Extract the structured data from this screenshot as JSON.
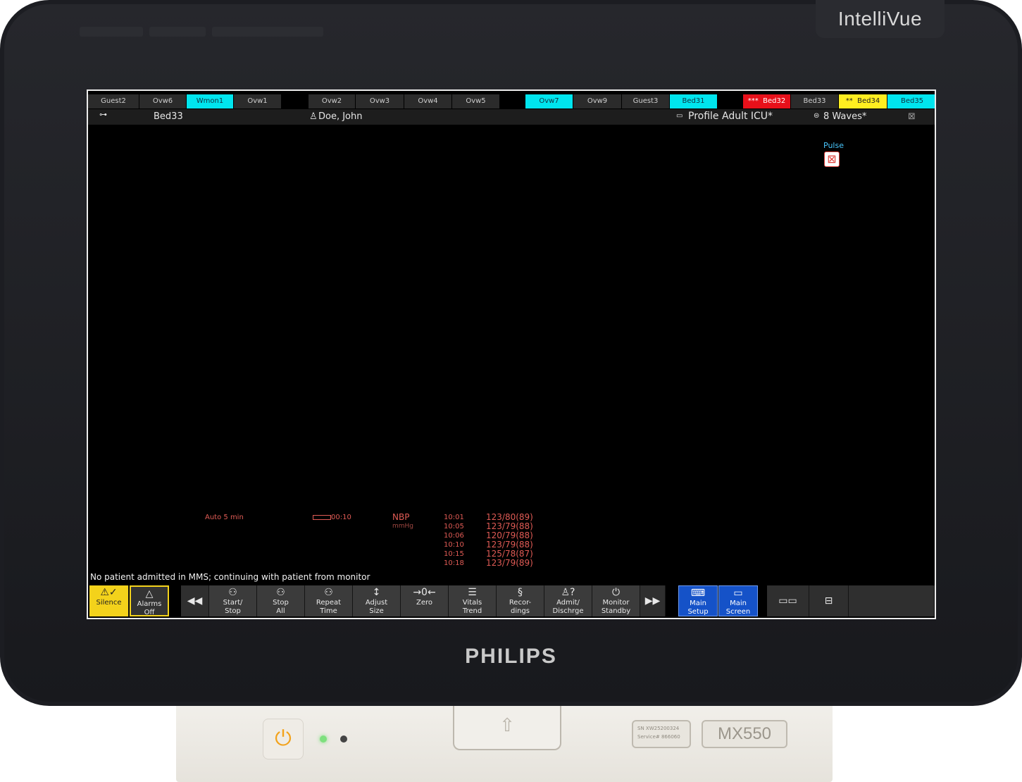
{
  "brand": {
    "product": "IntelliVue",
    "maker": "PHILIPS",
    "model": "MX550"
  },
  "serial_label": {
    "sn": "SN XW25200324",
    "service": "Service# 866060"
  },
  "tabs": [
    {
      "label": "Guest2",
      "state": "normal"
    },
    {
      "label": "Ovw6",
      "state": "normal"
    },
    {
      "label": "Wmon1",
      "state": "cyan"
    },
    {
      "label": "Ovw1",
      "state": "normal"
    },
    {
      "label": "Ovw2",
      "state": "normal"
    },
    {
      "label": "Ovw3",
      "state": "normal"
    },
    {
      "label": "Ovw4",
      "state": "normal"
    },
    {
      "label": "Ovw5",
      "state": "normal"
    },
    {
      "label": "Ovw7",
      "state": "cyan"
    },
    {
      "label": "Ovw9",
      "state": "normal"
    },
    {
      "label": "Guest3",
      "state": "normal"
    },
    {
      "label": "Bed31",
      "state": "cyan"
    },
    {
      "label": "Bed32",
      "state": "red",
      "prefix": "***"
    },
    {
      "label": "Bed33",
      "state": "normal"
    },
    {
      "label": "Bed34",
      "state": "yellow",
      "prefix": "**"
    },
    {
      "label": "Bed35",
      "state": "cyan"
    }
  ],
  "status": {
    "bed": "Bed33",
    "patient": "Doe, John",
    "profile": "Profile Adult ICU*",
    "waves": "8 Waves*"
  },
  "pulse": {
    "label": "Pulse"
  },
  "nbp": {
    "mode": "Auto 5 min",
    "timer": "00:10",
    "label": "NBP",
    "unit": "mmHg",
    "readings": [
      {
        "time": "10:01",
        "value": "123/80(89)"
      },
      {
        "time": "10:05",
        "value": "123/79(88)"
      },
      {
        "time": "10:06",
        "value": "120/79(88)"
      },
      {
        "time": "10:10",
        "value": "123/79(88)"
      },
      {
        "time": "10:15",
        "value": "125/78(87)"
      },
      {
        "time": "10:18",
        "value": "123/79(89)"
      }
    ]
  },
  "message": "No patient admitted in MMS; continuing with patient from monitor",
  "buttons": {
    "silence": "Silence",
    "alarms_off_1": "Alarms",
    "alarms_off_2": "Off",
    "start_stop_1": "Start/",
    "start_stop_2": "Stop",
    "stop_all_1": "Stop",
    "stop_all_2": "All",
    "repeat_time_1": "Repeat",
    "repeat_time_2": "Time",
    "adjust_size_1": "Adjust",
    "adjust_size_2": "Size",
    "zero": "Zero",
    "vitals_trend_1": "Vitals",
    "vitals_trend_2": "Trend",
    "recordings_1": "Recor-",
    "recordings_2": "dings",
    "admit_1": "Admit/",
    "admit_2": "Dischrge",
    "standby_1": "Monitor",
    "standby_2": "Standby",
    "main_setup_1": "Main",
    "main_setup_2": "Setup",
    "main_screen_1": "Main",
    "main_screen_2": "Screen"
  }
}
